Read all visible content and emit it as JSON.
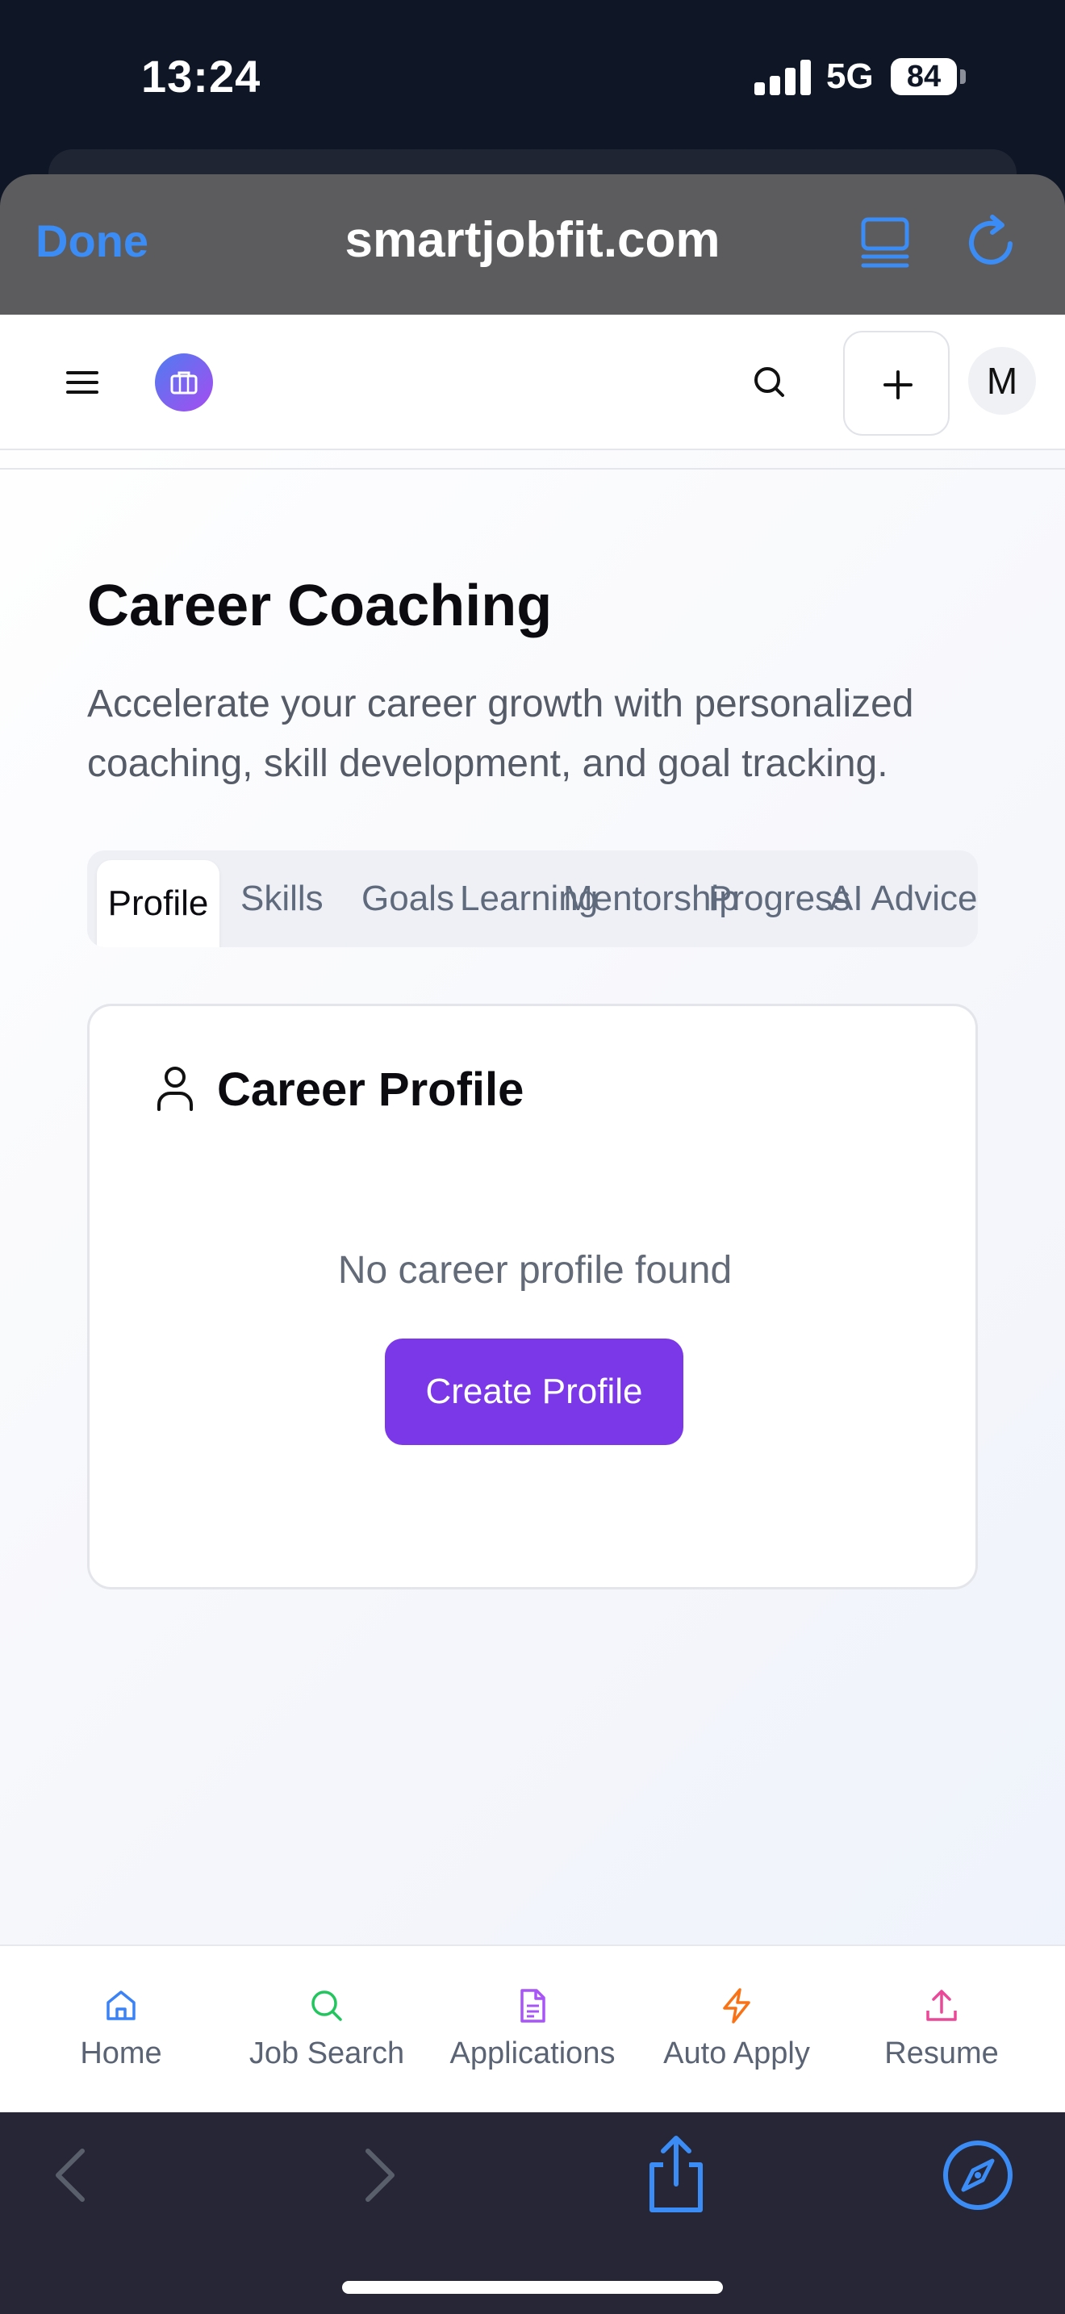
{
  "status_bar": {
    "time": "13:24",
    "network": "5G",
    "battery": "84"
  },
  "browser": {
    "done_label": "Done",
    "url": "smartjobfit.com"
  },
  "header": {
    "avatar_initial": "M"
  },
  "page": {
    "title": "Career Coaching",
    "description": "Accelerate your career growth with personalized coaching, skill development, and goal tracking."
  },
  "tabs": [
    "Profile",
    "Skills",
    "Goals",
    "Learning",
    "Mentorship",
    "Progress",
    "AI Advice"
  ],
  "card": {
    "title": "Career Profile",
    "empty_text": "No career profile found",
    "button_label": "Create Profile"
  },
  "bottom_nav": [
    {
      "label": "Home",
      "icon": "home-icon",
      "color": "#3b82f6"
    },
    {
      "label": "Job Search",
      "icon": "search-icon",
      "color": "#22c55e"
    },
    {
      "label": "Applications",
      "icon": "document-icon",
      "color": "#a855f7"
    },
    {
      "label": "Auto Apply",
      "icon": "lightning-icon",
      "color": "#f97316"
    },
    {
      "label": "Resume",
      "icon": "upload-icon",
      "color": "#ec4899"
    }
  ],
  "colors": {
    "accent": "#7a38e8",
    "safari_blue": "#3b8cf5"
  }
}
